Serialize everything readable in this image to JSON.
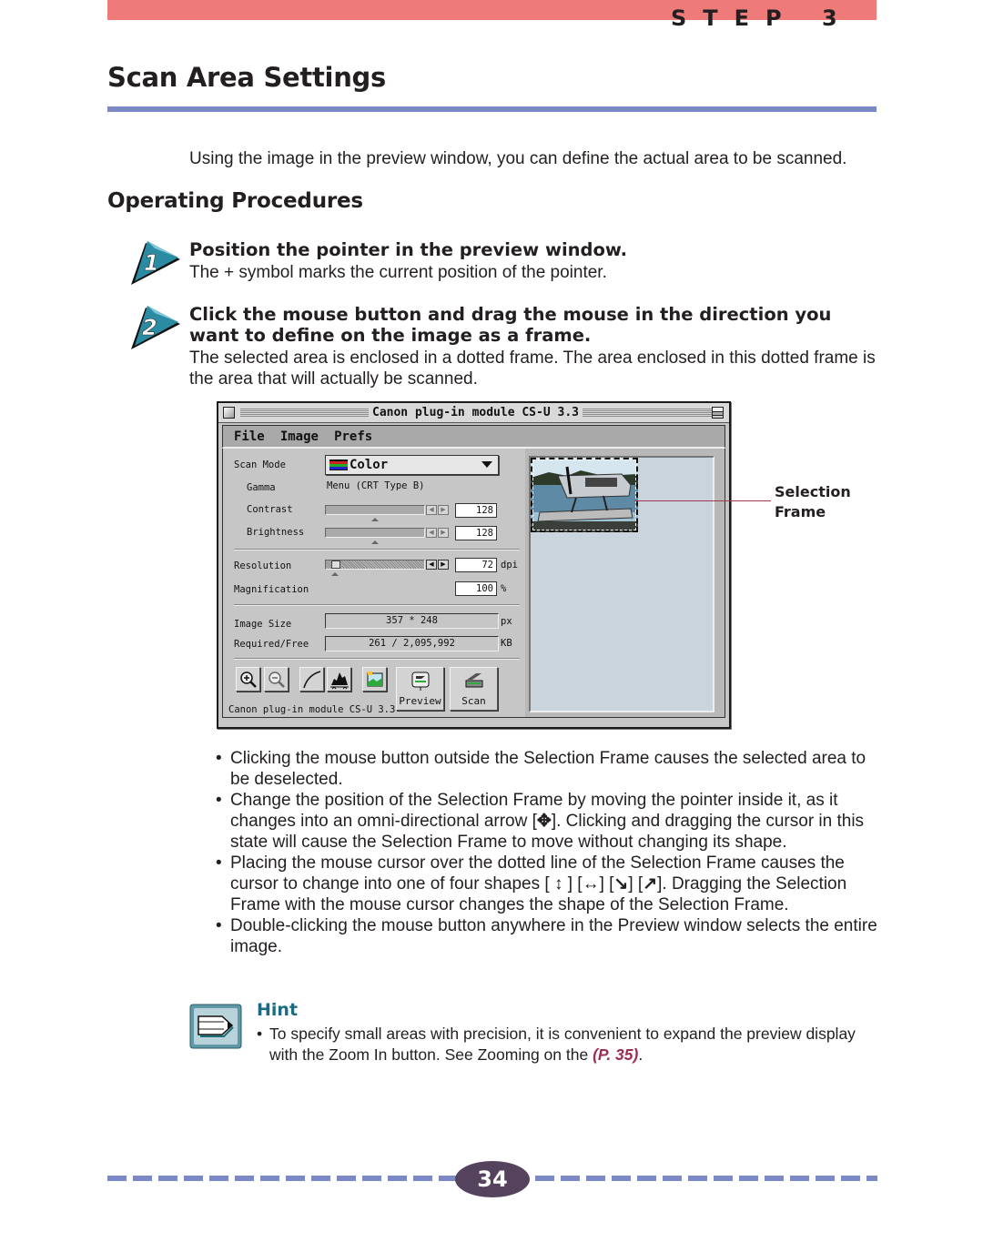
{
  "header": {
    "step_label": "STEP 3",
    "page_title": "Scan Area Settings"
  },
  "intro": "Using the image in the preview window, you can define the actual area to be scanned.",
  "section_heading": "Operating Procedures",
  "steps": [
    {
      "number": "1",
      "title": "Position the pointer in the preview window.",
      "body": "The + symbol marks the current position of the pointer."
    },
    {
      "number": "2",
      "title": "Click the mouse button and drag the mouse in the direction you want to define on the image as a frame.",
      "body": "The selected area is enclosed in a dotted frame.  The area enclosed in this dotted frame is the area that will actually be scanned."
    }
  ],
  "window": {
    "title": "Canon plug-in module CS-U 3.3",
    "menu": [
      "File",
      "Image",
      "Prefs"
    ],
    "labels": {
      "scan_mode": "Scan Mode",
      "gamma": "Gamma",
      "contrast": "Contrast",
      "brightness": "Brightness",
      "resolution": "Resolution",
      "magnification": "Magnification",
      "image_size": "Image Size",
      "required_free": "Required/Free"
    },
    "scan_mode_value": "Color",
    "gamma_value": "Menu (CRT Type B)",
    "contrast_value": "128",
    "brightness_value": "128",
    "resolution_value": "72",
    "resolution_unit": "dpi",
    "magnification_value": "100",
    "magnification_unit": "%",
    "image_size_value": "357 * 248",
    "image_size_unit": "px",
    "required_free_value": "261 / 2,095,992",
    "required_free_unit": "KB",
    "sliders": {
      "contrast_level": 0.5,
      "brightness_level": 0.5,
      "resolution_level": 0.1
    },
    "buttons": {
      "preview": "Preview",
      "scan": "Scan"
    },
    "tool_icons": [
      "zoom-in-icon",
      "zoom-out-icon",
      "tone-curve-icon",
      "histogram-icon",
      "image-icon"
    ],
    "footer_label": "Canon plug-in module CS-U 3.3"
  },
  "callout": {
    "line1": "Selection",
    "line2": "Frame"
  },
  "bullets": [
    {
      "text": "Clicking the mouse button outside the Selection Frame causes the selected area to be deselected."
    },
    {
      "pre": "Change the position of the Selection Frame by moving the pointer inside it, as it changes into an omni-directional arrow [",
      "icon": "✥",
      "post": "]. Clicking and dragging the cursor in this state will cause the Selection Frame to move without changing its shape."
    },
    {
      "pre": "Placing the mouse cursor over the dotted line of the Selection Frame causes the cursor to change into one of four shapes [ ",
      "icons": [
        "↕",
        "↔",
        "↘",
        "↗"
      ],
      "post": "]. Dragging the Selection Frame with the mouse cursor changes the shape of the Selection Frame."
    },
    {
      "text": "Double-clicking the mouse button anywhere in the Preview window selects the entire image."
    }
  ],
  "hint": {
    "title": "Hint",
    "body_pre": "To specify small areas with precision, it is convenient to expand the preview display with the Zoom In button. See Zooming on the ",
    "link": "(P. 35)",
    "body_post": "."
  },
  "footer": {
    "page_number": "34"
  },
  "colors": {
    "top_bar": "#ee7b79",
    "rule": "#7b89c5",
    "hint_title": "#1b6b83",
    "link": "#9a2f54",
    "page_badge": "#55425c"
  }
}
